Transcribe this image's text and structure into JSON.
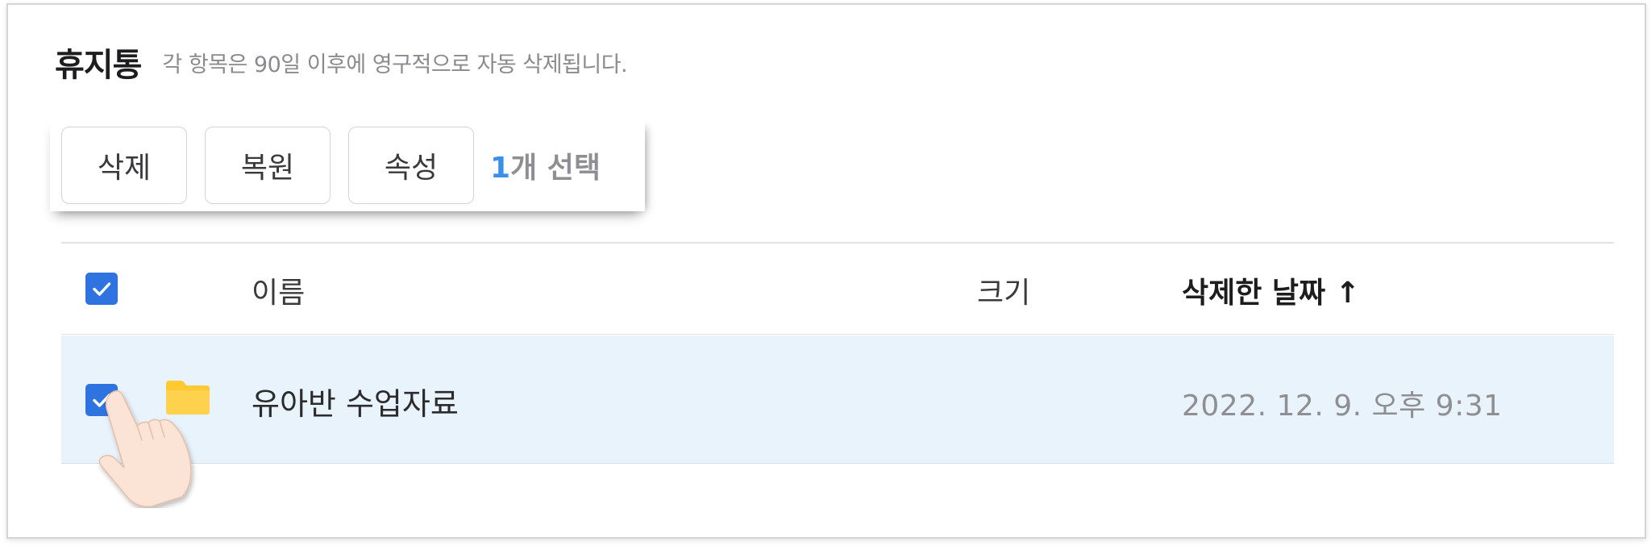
{
  "page": {
    "title": "휴지통",
    "subtitle": "각 항목은 90일 이후에 영구적으로 자동 삭제됩니다."
  },
  "toolbar": {
    "delete_label": "삭제",
    "restore_label": "복원",
    "properties_label": "속성",
    "selection_count": "1",
    "selection_suffix": "개 선택"
  },
  "table": {
    "columns": {
      "name": "이름",
      "size": "크기",
      "deleted_date": "삭제한 날짜 ↑"
    },
    "header_checkbox_checked": true,
    "rows": [
      {
        "checked": true,
        "icon": "folder-icon",
        "name": "유아반 수업자료",
        "size": "",
        "deleted_date": "2022. 12. 9. 오후 9:31"
      }
    ]
  },
  "colors": {
    "accent": "#2f73e0",
    "selection_count": "#3b8fe8",
    "row_selected_bg": "#e9f3fc",
    "folder": "#ffc933"
  }
}
